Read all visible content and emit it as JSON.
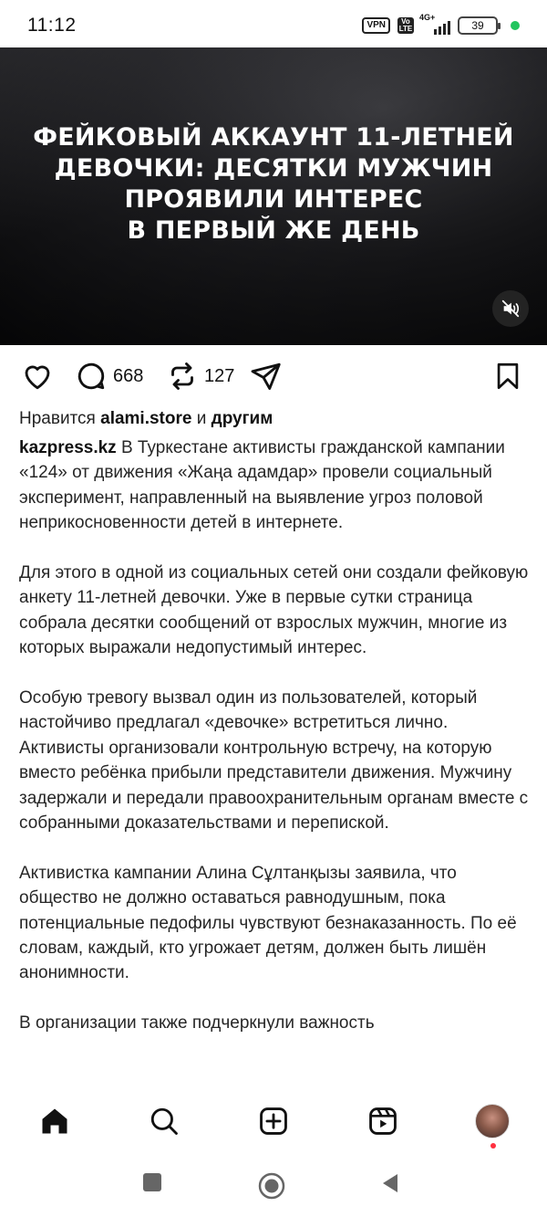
{
  "status_bar": {
    "time": "11:12",
    "vpn": "VPN",
    "volte": "Vo LTE",
    "network": "4G+",
    "battery": "39",
    "dot_color": "#22c55e"
  },
  "video": {
    "title": "ФЕЙКОВЫЙ АККАУНТ 11-ЛЕТНЕЙ\nДЕВОЧКИ: ДЕСЯТКИ МУЖЧИН\nПРОЯВИЛИ ИНТЕРЕС\nВ ПЕРВЫЙ ЖЕ ДЕНЬ",
    "mute_icon": "speaker-muted-icon"
  },
  "actions": {
    "comments_count": "668",
    "reposts_count": "127",
    "icons": [
      "heart-icon",
      "comment-icon",
      "repost-icon",
      "send-icon",
      "bookmark-icon"
    ]
  },
  "likes": {
    "prefix": "Нравится",
    "user": "alami.store",
    "conj": "и",
    "others": "другим"
  },
  "caption": {
    "username": "kazpress.kz",
    "paragraphs": [
      "В Туркестане активисты гражданской кампании «124» от движения «Жаңа адамдар» провели социальный эксперимент, направленный на выявление угроз половой неприкосновенности детей в интернете.",
      "Для этого в одной из социальных сетей они создали фейковую анкету 11-летней девочки. Уже в первые сутки страница собрала десятки сообщений от взрослых мужчин, многие из которых выражали недопустимый интерес.",
      "Особую тревогу вызвал один из пользователей, который настойчиво предлагал «девочке» встретиться лично. Активисты организовали контрольную встречу, на которую вместо ребёнка прибыли представители движения. Мужчину задержали и передали правоохранительным органам вместе с собранными доказательствами и перепиской.",
      "Активистка кампании Алина Сұлтанқызы заявила, что общество не должно оставаться равнодушным, пока потенциальные педофилы чувствуют безнаказанность. По её словам, каждый, кто угрожает детям, должен быть лишён анонимности.",
      "В организации также подчеркнули важность"
    ]
  },
  "bottom_nav": {
    "items": [
      "home-icon",
      "search-icon",
      "create-icon",
      "reels-icon",
      "profile-avatar"
    ],
    "notification_color": "#ff3040"
  },
  "system_nav": {
    "items": [
      "recents-icon",
      "home-circle-icon",
      "back-icon"
    ]
  }
}
